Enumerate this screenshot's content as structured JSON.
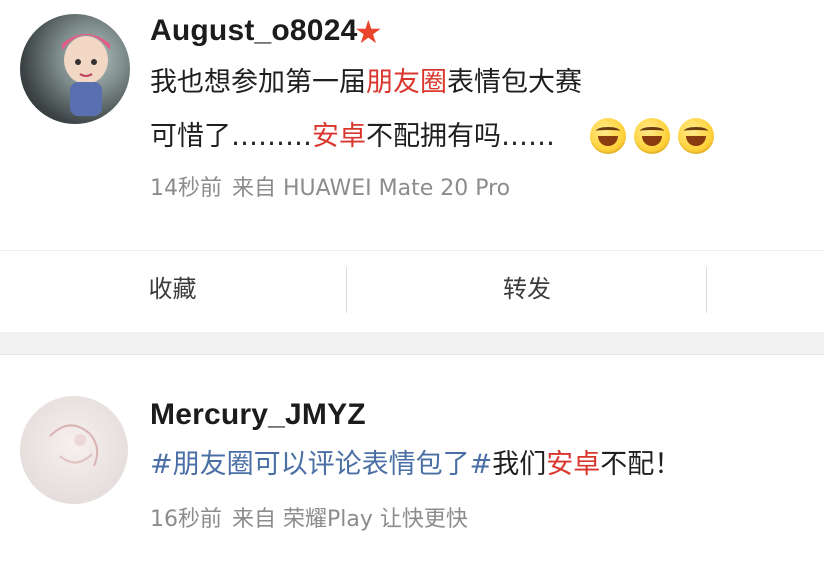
{
  "posts": [
    {
      "username": "August_o8024",
      "badge_icon": "star-icon",
      "badge_color": "#e8452c",
      "line1": {
        "a": "我也想参加第一届",
        "b": "朋友圈",
        "c": "表情包大赛"
      },
      "line2": {
        "a": "可惜了………",
        "b": "安卓",
        "c": "不配拥有吗……"
      },
      "emojis": [
        "laughing-crying-emoji",
        "laughing-crying-emoji",
        "laughing-crying-emoji"
      ],
      "time": "14秒前",
      "source": "来自 HUAWEI Mate 20 Pro"
    },
    {
      "username": "Mercury_JMYZ",
      "line1": {
        "a": "#朋友圈可以评论表情包了#",
        "b": "我们",
        "c": "安卓",
        "d": "不配！"
      },
      "time": "16秒前",
      "source": "来自 荣耀Play 让快更快"
    }
  ],
  "actions": {
    "favorite": "收藏",
    "forward": "转发"
  },
  "colors": {
    "highlight": "#d9372e",
    "hashtag": "#4a6fa5",
    "meta": "#8c8c8c"
  }
}
